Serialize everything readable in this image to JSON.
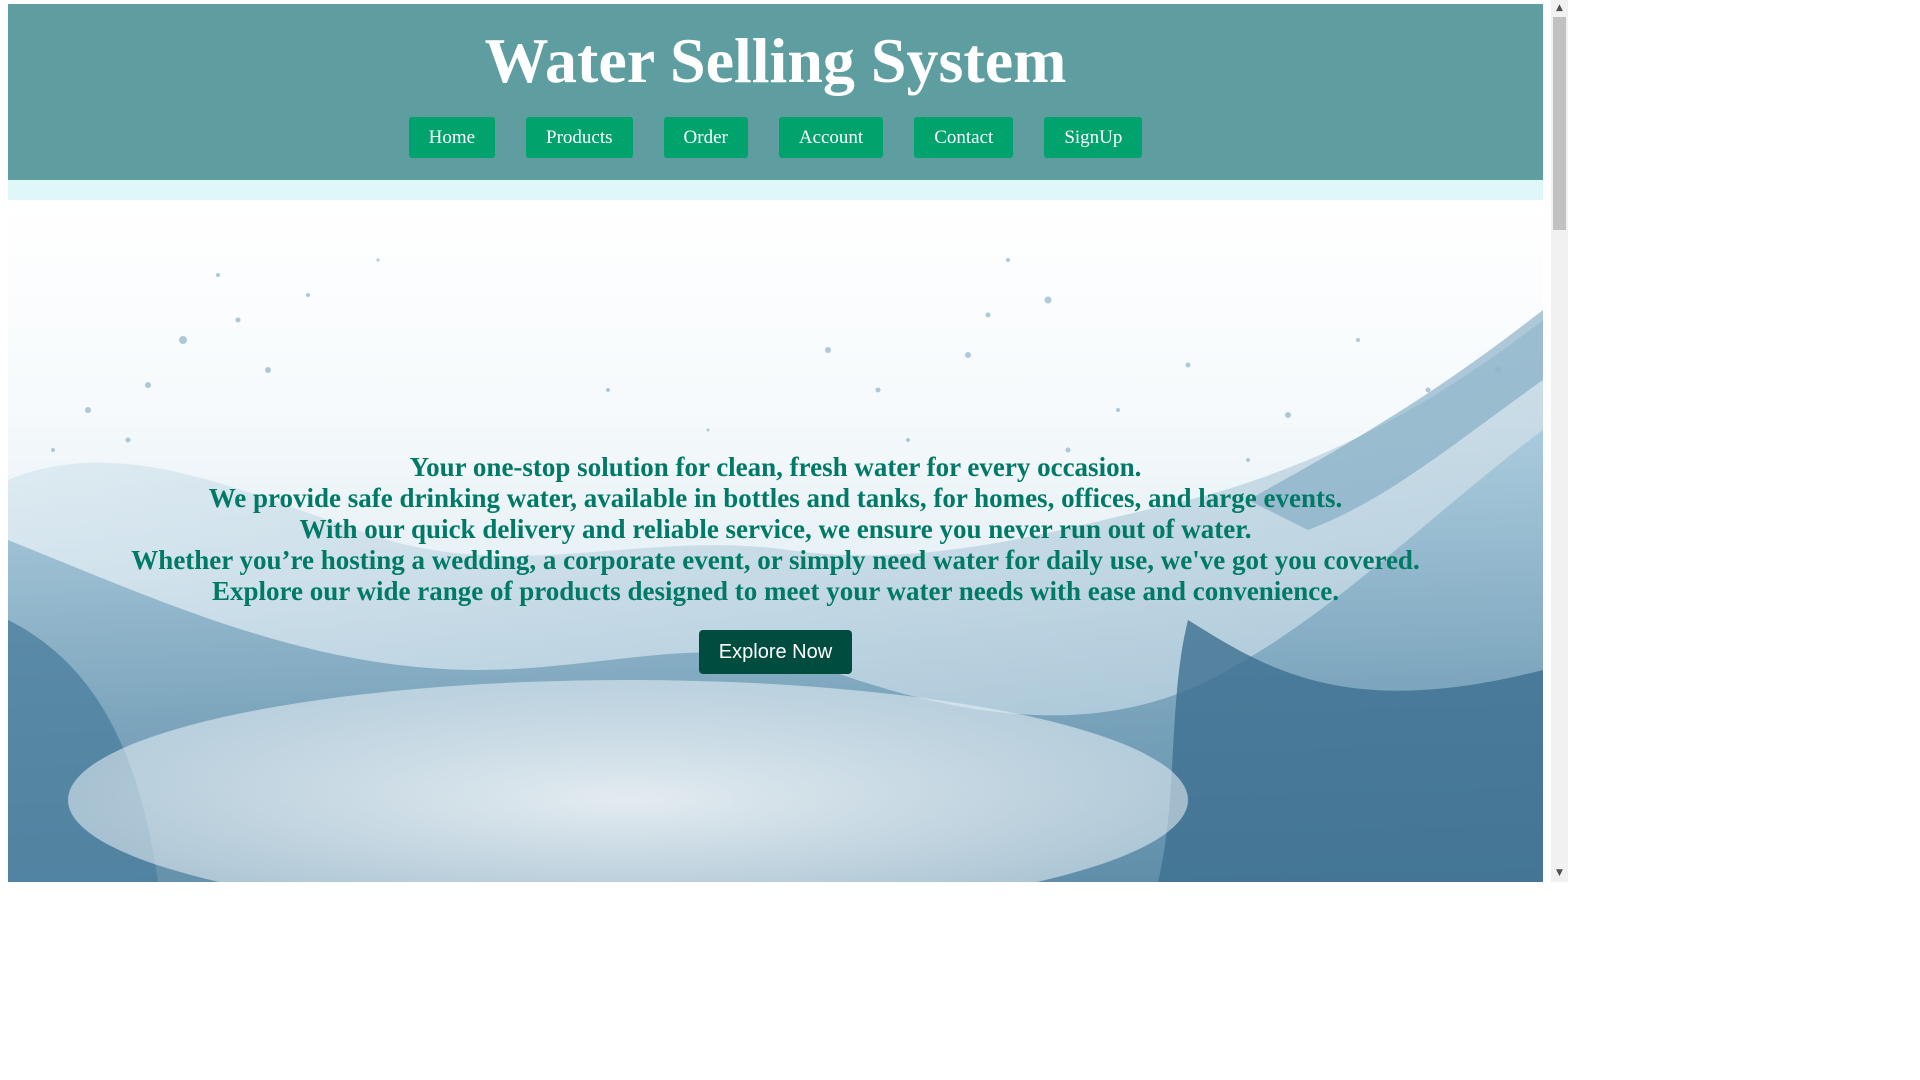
{
  "header": {
    "title": "Water Selling System",
    "nav": [
      {
        "label": "Home"
      },
      {
        "label": "Products"
      },
      {
        "label": "Order"
      },
      {
        "label": "Account"
      },
      {
        "label": "Contact"
      },
      {
        "label": "SignUp"
      }
    ]
  },
  "hero": {
    "lines": [
      "Your one-stop solution for clean, fresh water for every occasion.",
      "We provide safe drinking water, available in bottles and tanks, for homes, offices, and large events.",
      "With our quick delivery and reliable service, we ensure you never run out of water.",
      "Whether you’re hosting a wedding, a corporate event, or simply need water for daily use, we've got you covered.",
      "Explore our wide range of products designed to meet your water needs with ease and convenience."
    ],
    "cta_label": "Explore Now",
    "background_icon": "water-splash-image"
  },
  "scrollbar": {
    "up_icon": "▲",
    "down_icon": "▼"
  },
  "colors": {
    "header_bg": "#5f9ea0",
    "nav_button_bg": "#00a36c",
    "strip_bg": "#e0f7f7",
    "hero_text": "#007a66",
    "cta_bg": "#004d40"
  }
}
